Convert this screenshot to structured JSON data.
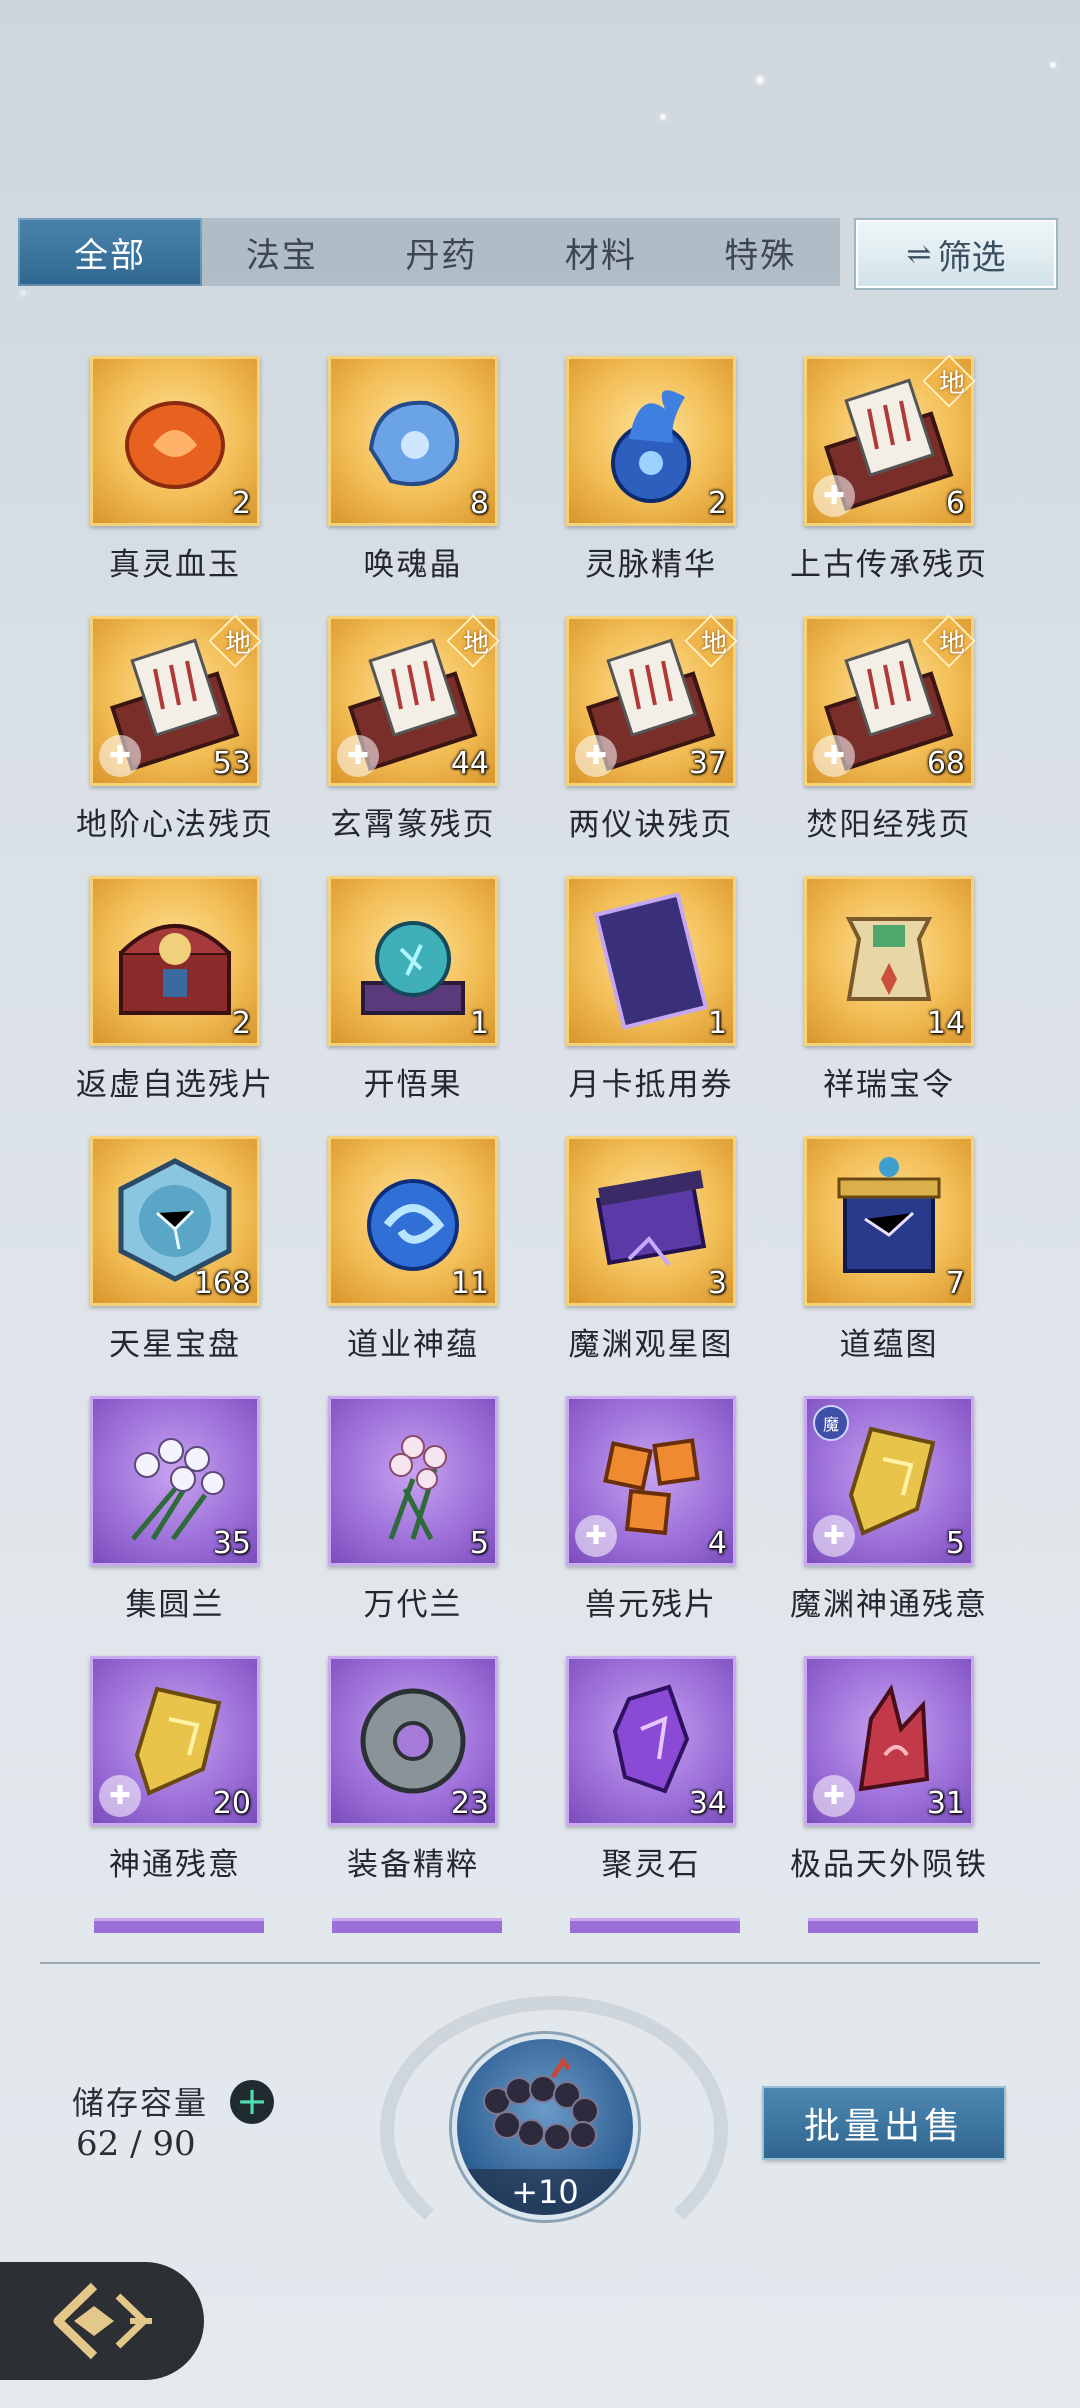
{
  "tabs": [
    {
      "label": "全部",
      "active": true
    },
    {
      "label": "法宝",
      "active": false
    },
    {
      "label": "丹药",
      "active": false
    },
    {
      "label": "材料",
      "active": false
    },
    {
      "label": "特殊",
      "active": false
    }
  ],
  "filter": {
    "icon": "swap-arrows-icon",
    "label": "筛选"
  },
  "items": [
    {
      "name": "真灵血玉",
      "count": "2",
      "rarity": "gold",
      "icon": "blood-jade-icon"
    },
    {
      "name": "唤魂晶",
      "count": "8",
      "rarity": "gold",
      "icon": "soul-crystal-icon"
    },
    {
      "name": "灵脉精华",
      "count": "2",
      "rarity": "gold",
      "icon": "spirit-flame-icon"
    },
    {
      "name": "上古传承残页",
      "count": "6",
      "rarity": "gold",
      "icon": "scroll-box-icon",
      "fragment": true,
      "tier": "地"
    },
    {
      "name": "地阶心法残页",
      "count": "53",
      "rarity": "gold",
      "icon": "scroll-box-icon",
      "fragment": true,
      "tier": "地"
    },
    {
      "name": "玄霄篆残页",
      "count": "44",
      "rarity": "gold",
      "icon": "scroll-box-icon",
      "fragment": true,
      "tier": "地"
    },
    {
      "name": "两仪诀残页",
      "count": "37",
      "rarity": "gold",
      "icon": "scroll-box-icon",
      "fragment": true,
      "tier": "地"
    },
    {
      "name": "焚阳经残页",
      "count": "68",
      "rarity": "gold",
      "icon": "scroll-box-icon",
      "fragment": true,
      "tier": "地"
    },
    {
      "name": "返虚自选残片",
      "count": "2",
      "rarity": "gold",
      "icon": "treasure-chest-icon"
    },
    {
      "name": "开悟果",
      "count": "1",
      "rarity": "gold",
      "icon": "crystal-orb-icon"
    },
    {
      "name": "月卡抵用券",
      "count": "1",
      "rarity": "gold",
      "icon": "moon-card-icon"
    },
    {
      "name": "祥瑞宝令",
      "count": "14",
      "rarity": "gold",
      "icon": "token-icon"
    },
    {
      "name": "天星宝盘",
      "count": "168",
      "rarity": "gold",
      "icon": "star-disk-icon"
    },
    {
      "name": "道业神蕴",
      "count": "11",
      "rarity": "gold",
      "icon": "blue-swirl-icon"
    },
    {
      "name": "魔渊观星图",
      "count": "3",
      "rarity": "gold",
      "icon": "purple-scroll-icon"
    },
    {
      "name": "道蕴图",
      "count": "7",
      "rarity": "gold",
      "icon": "star-map-scroll-icon"
    },
    {
      "name": "集圆兰",
      "count": "35",
      "rarity": "purple",
      "icon": "white-orchid-icon"
    },
    {
      "name": "万代兰",
      "count": "5",
      "rarity": "purple",
      "icon": "pink-orchid-icon"
    },
    {
      "name": "兽元残片",
      "count": "4",
      "rarity": "purple",
      "icon": "orange-shards-icon",
      "fragment": true
    },
    {
      "name": "魔渊神通残意",
      "count": "5",
      "rarity": "purple",
      "icon": "gold-fragment-icon",
      "fragment": true,
      "badge": "魔"
    },
    {
      "name": "神通残意",
      "count": "20",
      "rarity": "purple",
      "icon": "gold-fragment-icon",
      "fragment": true
    },
    {
      "name": "装备精粹",
      "count": "23",
      "rarity": "purple",
      "icon": "stone-ring-icon"
    },
    {
      "name": "聚灵石",
      "count": "34",
      "rarity": "purple",
      "icon": "purple-crystal-icon"
    },
    {
      "name": "极品天外陨铁",
      "count": "31",
      "rarity": "purple",
      "icon": "red-crystal-icon",
      "fragment": true
    }
  ],
  "storage": {
    "label": "储存容量",
    "value": "62 / 90"
  },
  "center": {
    "icon": "bead-bracelet-icon",
    "label": "+10"
  },
  "sell": {
    "label": "批量出售"
  },
  "back": {
    "icon": "back-arrow-icon"
  },
  "colors": {
    "gold_rarity": "#f2bd55",
    "purple_rarity": "#9b6ed8",
    "active_tab": "#3a77a0"
  }
}
